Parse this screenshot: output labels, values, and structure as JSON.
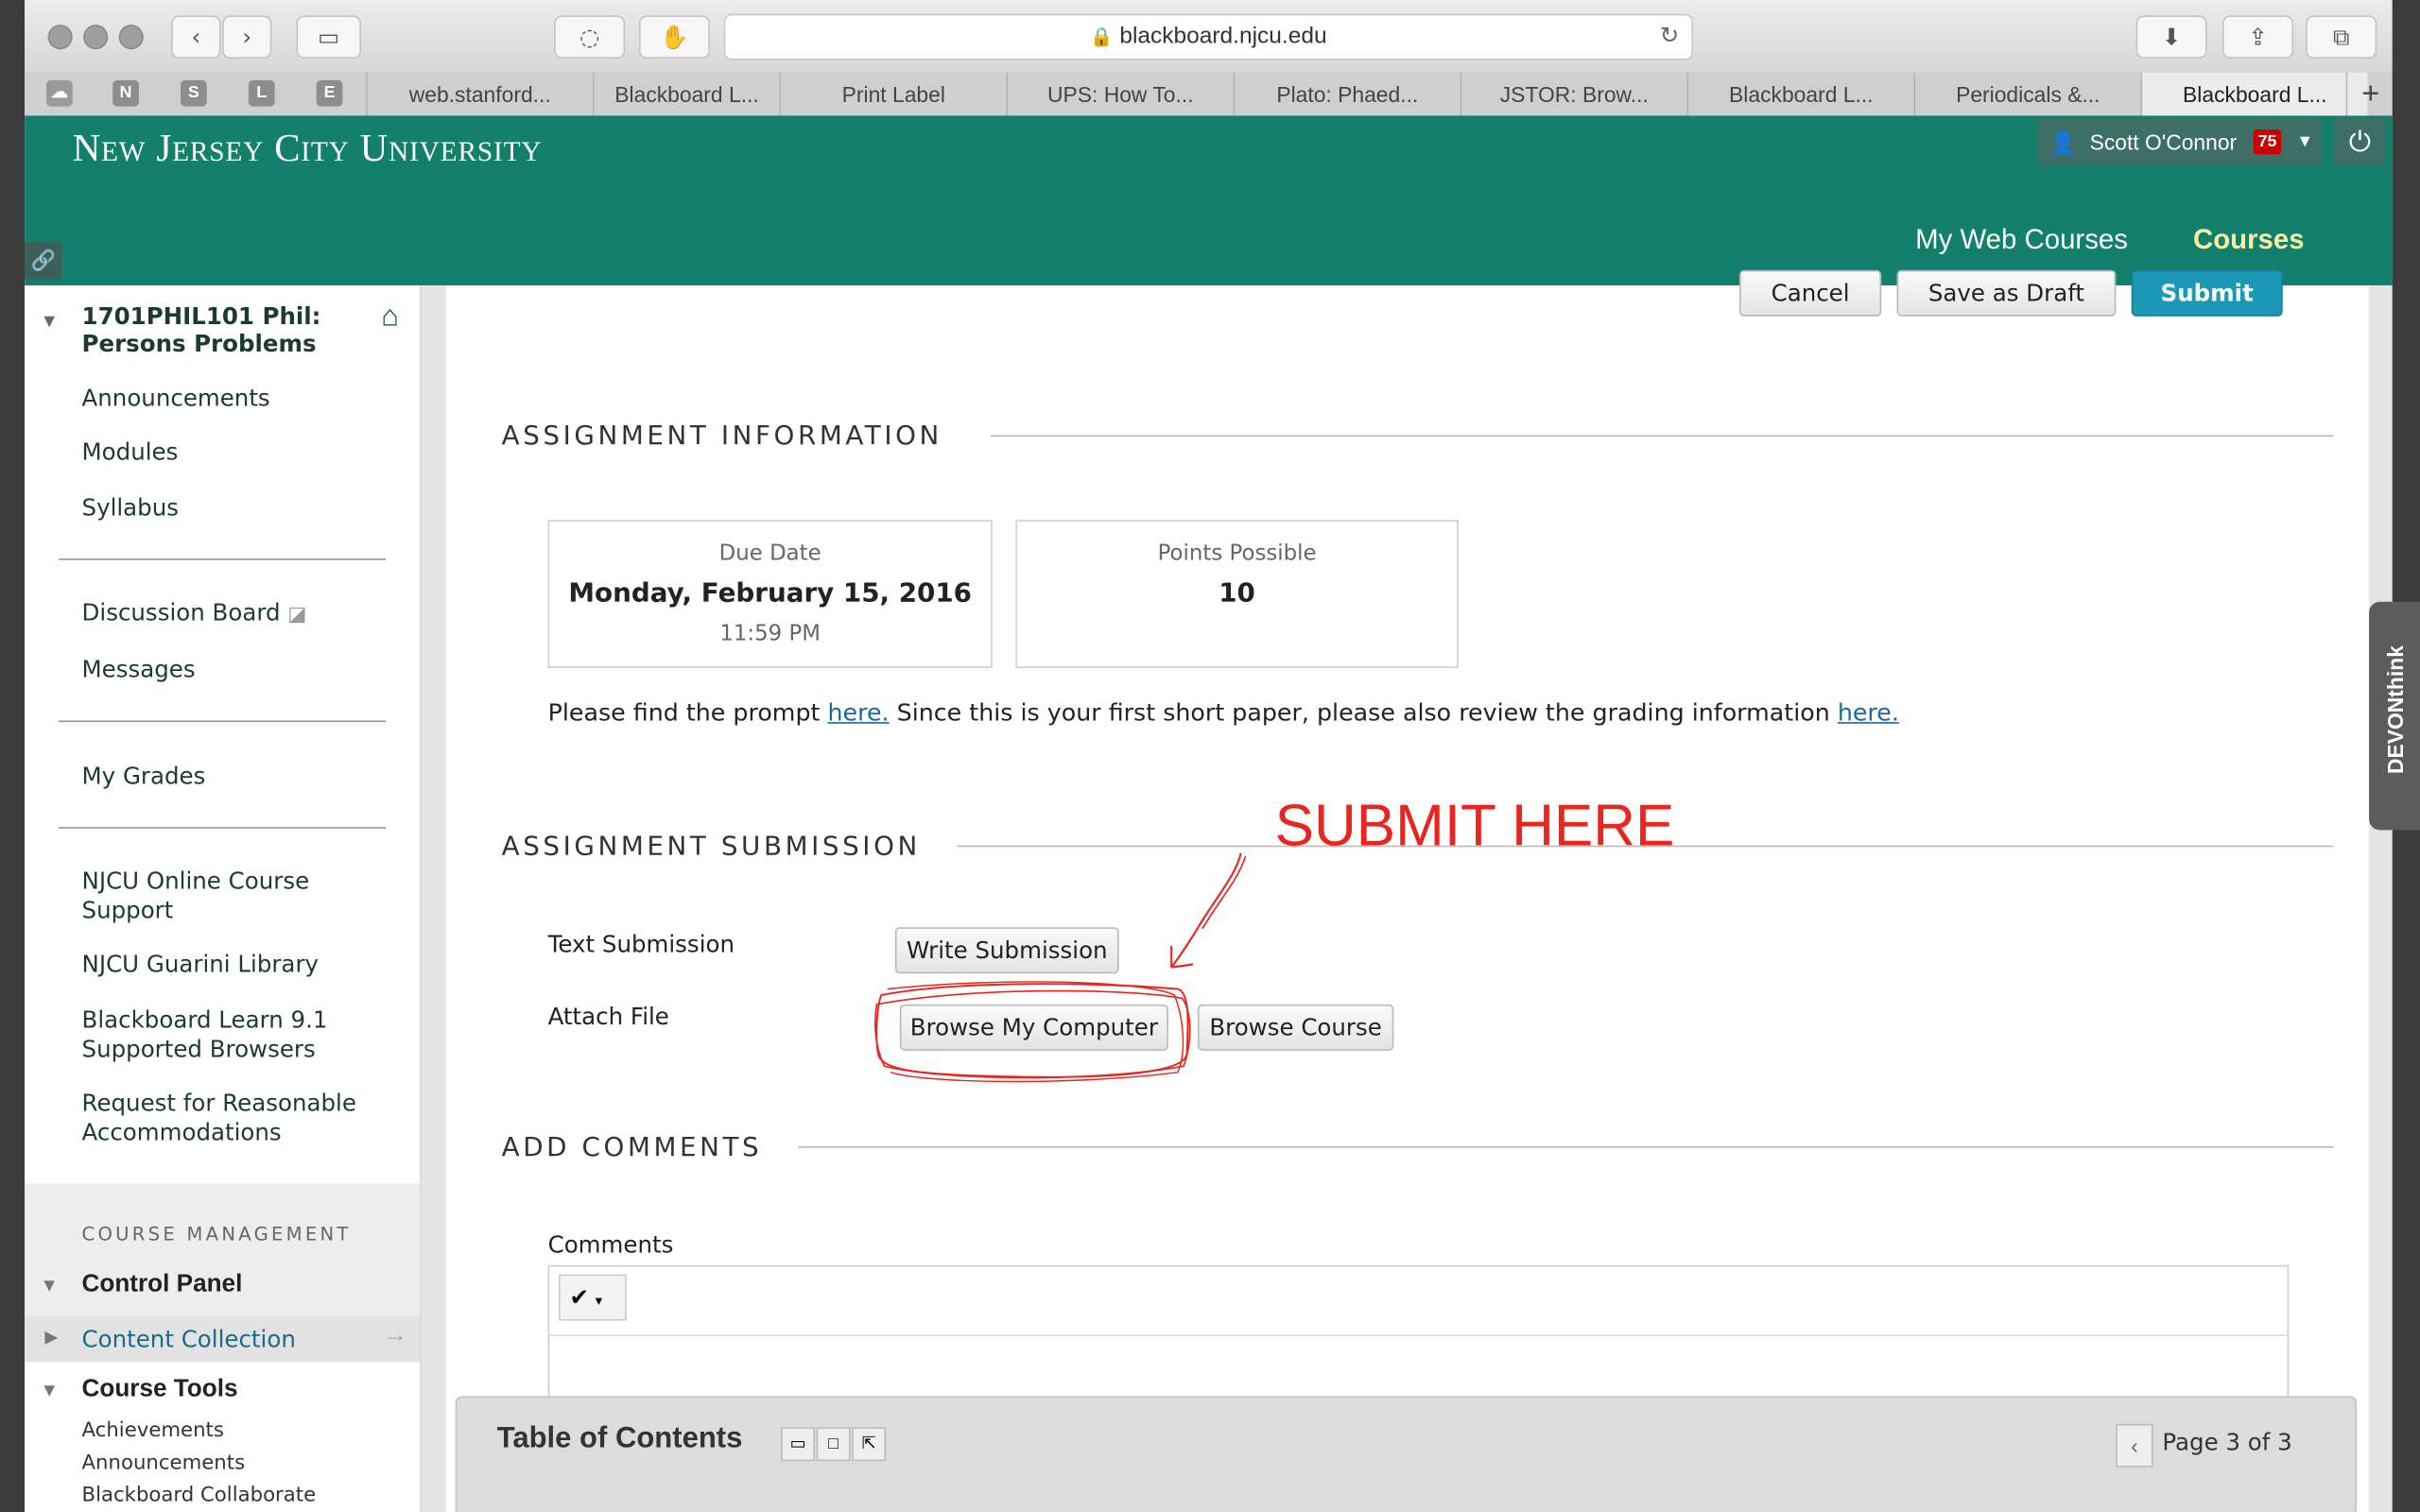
{
  "browser": {
    "url": "blackboard.njcu.edu",
    "pinned": [
      "N",
      "S",
      "L",
      "E"
    ],
    "tabs": [
      "web.stanford...",
      "Blackboard L...",
      "Print Label",
      "UPS: How To...",
      "Plato: Phaed...",
      "JSTOR: Brow...",
      "Blackboard L...",
      "Periodicals &...",
      "Blackboard L..."
    ]
  },
  "header": {
    "logo": "New Jersey City University",
    "user_name": "Scott O'Connor",
    "notifications": "75",
    "nav_my_courses": "My Web Courses",
    "nav_courses": "Courses"
  },
  "sidebar": {
    "course_title": "1701PHIL101 Phil: Persons Problems",
    "items_group1": [
      "Announcements",
      "Modules",
      "Syllabus"
    ],
    "items_group2": [
      "Discussion Board",
      "Messages"
    ],
    "items_group3": [
      "My Grades"
    ],
    "items_group4": [
      "NJCU Online Course Support",
      "NJCU Guarini Library",
      "Blackboard Learn 9.1 Supported Browsers",
      "Request for Reasonable Accommodations"
    ],
    "management_heading": "COURSE MANAGEMENT",
    "control_panel": "Control Panel",
    "content_collection": "Content Collection",
    "course_tools": "Course Tools",
    "tools": [
      "Achievements",
      "Announcements",
      "Blackboard Collaborate"
    ]
  },
  "toolbar_buttons": {
    "cancel": "Cancel",
    "save_draft": "Save as Draft",
    "submit": "Submit"
  },
  "assignment_info": {
    "heading": "ASSIGNMENT INFORMATION",
    "due_label": "Due Date",
    "due_date": "Monday, February 15, 2016",
    "due_time": "11:59 PM",
    "points_label": "Points Possible",
    "points": "10",
    "prompt_text_1": "Please find the prompt ",
    "prompt_link_1": "here.",
    "prompt_text_2": " Since this is your first short paper, please also review the grading information ",
    "prompt_link_2": "here."
  },
  "submission": {
    "heading": "ASSIGNMENT SUBMISSION",
    "annotation": "SUBMIT HERE",
    "text_label": "Text Submission",
    "write_button": "Write Submission",
    "attach_label": "Attach File",
    "browse_computer": "Browse My Computer",
    "browse_course": "Browse Course"
  },
  "comments": {
    "heading": "ADD COMMENTS",
    "label": "Comments"
  },
  "toc": {
    "title": "Table of Contents",
    "page": "Page 3 of 3"
  },
  "devonthink": {
    "label": "DEVONthink"
  },
  "colors": {
    "header_bg": "#13806d",
    "submit_bg": "#1d97b6",
    "annotation": "#e8251e"
  }
}
